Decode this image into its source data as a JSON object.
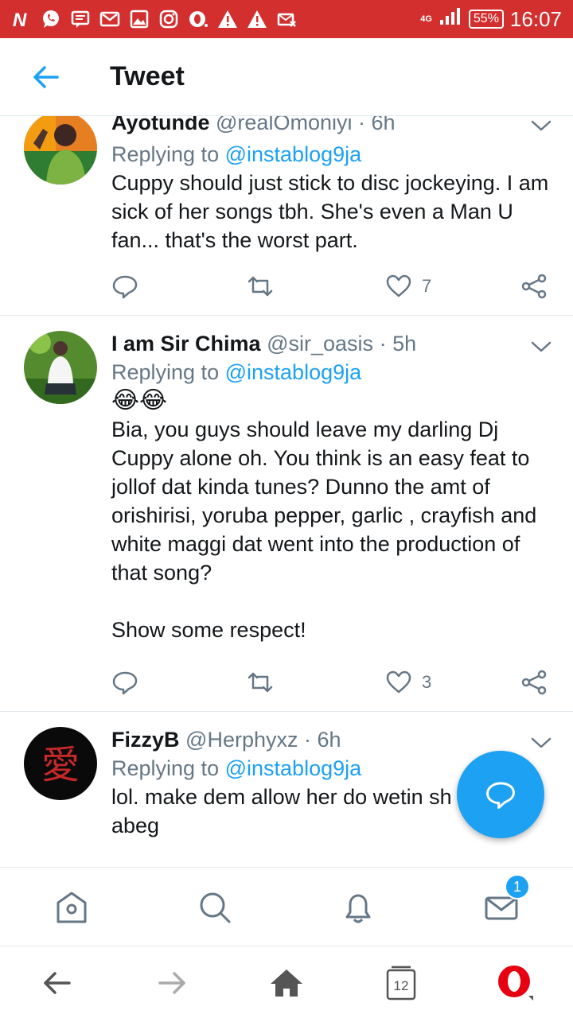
{
  "status_bar": {
    "network": "4G",
    "battery": "55%",
    "time": "16:07",
    "colors": {
      "background": "#d32f2f"
    }
  },
  "header": {
    "title": "Tweet"
  },
  "tweets": [
    {
      "name": "Ayotunde",
      "handle": "@realOmoniyi",
      "time": "6h",
      "replying_prefix": "Replying to",
      "replying_to": "@instablog9ja",
      "text": "Cuppy should just stick to disc jockeying. I am sick of her songs tbh. She's even a Man U fan... that's the worst part.",
      "likes": "7"
    },
    {
      "name": "I am Sir Chima",
      "handle": "@sir_oasis",
      "time": "5h",
      "replying_prefix": "Replying to",
      "replying_to": "@instablog9ja",
      "emoji": "😂😂",
      "text": "Bia, you guys should leave my darling Dj Cuppy alone oh. You think is an easy feat to jollof dat kinda tunes? Dunno the amt of orishirisi, yoruba pepper, garlic , crayfish and white maggi dat went into the production of that song?\n\nShow some respect!",
      "likes": "3"
    },
    {
      "name": "FizzyB",
      "handle": "@Herphyxz",
      "time": "6h",
      "replying_prefix": "Replying to",
      "replying_to": "@instablog9ja",
      "text": "lol. make dem allow her do wetin sh\nabeg"
    }
  ],
  "separator": "·",
  "bottom_nav": {
    "items": [
      "home-icon",
      "search-icon",
      "notifications-icon",
      "messages-icon"
    ],
    "messages_badge": "1"
  },
  "browser_bar": {
    "tab_count": "12"
  },
  "colors": {
    "accent": "#1da1f2",
    "secondary_text": "#657786",
    "divider": "#e1e8ed"
  }
}
